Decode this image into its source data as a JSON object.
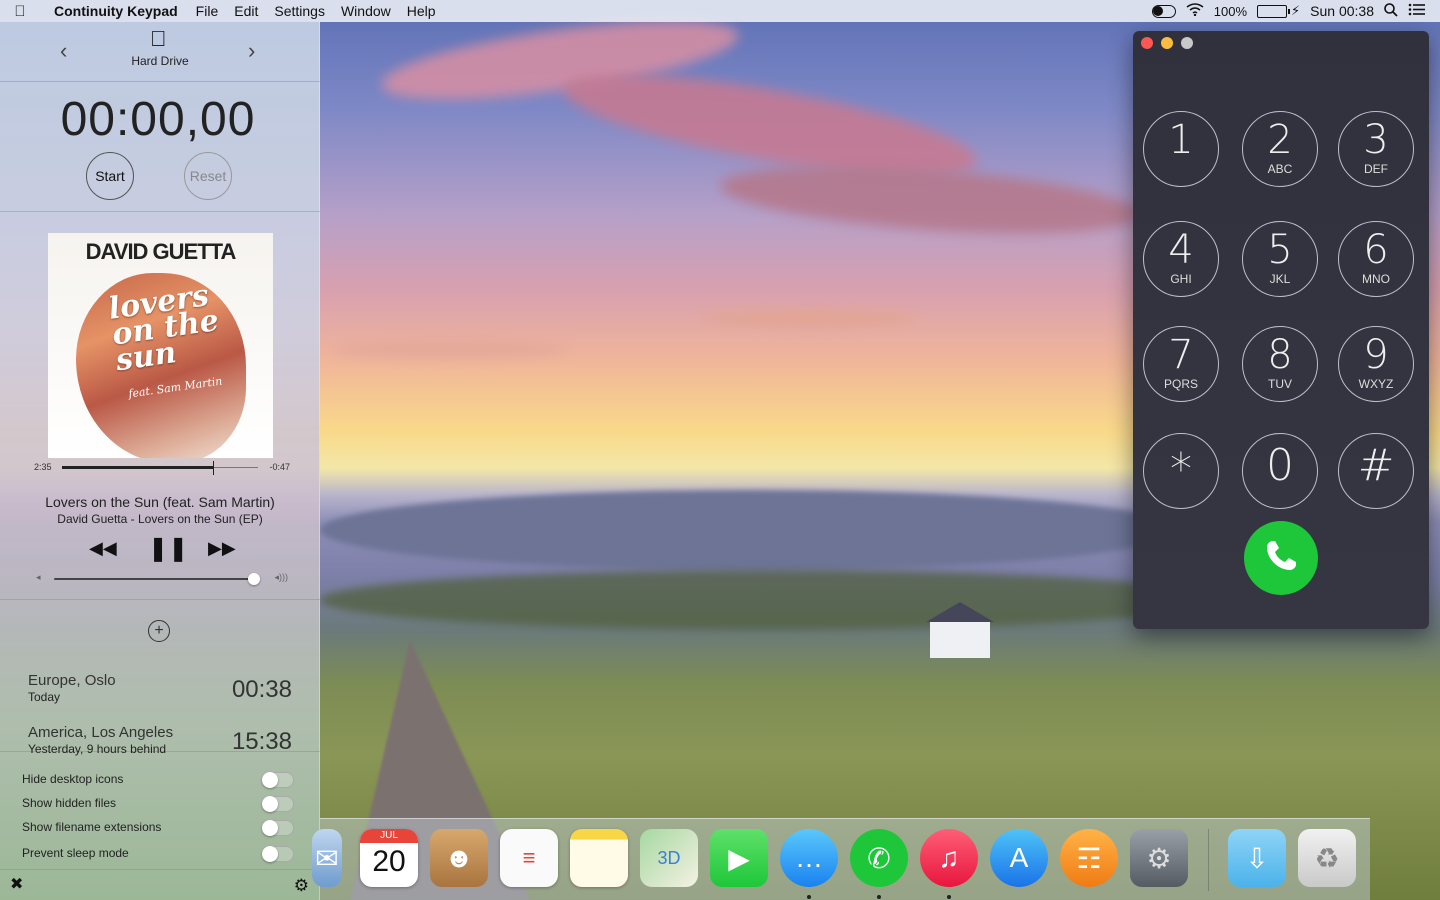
{
  "menubar": {
    "app_name": "Continuity Keypad",
    "menus": [
      "File",
      "Edit",
      "Settings",
      "Window",
      "Help"
    ],
    "battery_percent": "100%",
    "clock": "Sun 00:38",
    "icons": [
      "apple-icon",
      "toggle-icon",
      "wifi-icon",
      "battery-icon",
      "search-icon",
      "list-icon"
    ]
  },
  "panel": {
    "device": {
      "name": "Hard Drive",
      "prev_icon": "chevron-left-icon",
      "next_icon": "chevron-right-icon"
    },
    "stopwatch": {
      "display": "00:00,00",
      "start_label": "Start",
      "reset_label": "Reset"
    },
    "music": {
      "album_artist_logo": "DAVID GUETTA",
      "album_title": "lovers on the sun",
      "album_feat": "feat. Sam Martin",
      "elapsed": "2:35",
      "remaining": "-0:47",
      "progress": 0.77,
      "song_title": "Lovers on the Sun (feat. Sam Martin)",
      "song_subtitle": "David Guetta - Lovers on the Sun (EP)",
      "volume": 1.0
    },
    "world_clock": {
      "add_label": "+",
      "clocks": [
        {
          "city": "Europe, Oslo",
          "day": "Today",
          "time": "00:38"
        },
        {
          "city": "America, Los Angeles",
          "day": "Yesterday, 9 hours behind",
          "time": "15:38"
        }
      ]
    },
    "settings": {
      "items": [
        {
          "label": "Hide desktop icons",
          "on": false
        },
        {
          "label": "Show hidden files",
          "on": false
        },
        {
          "label": "Show filename extensions",
          "on": false
        },
        {
          "label": "Prevent sleep mode",
          "on": false
        }
      ]
    },
    "footer": {
      "close_icon": "close-icon",
      "gear_icon": "gear-icon"
    }
  },
  "keypad": {
    "keys": [
      {
        "digit": "1",
        "letters": ""
      },
      {
        "digit": "2",
        "letters": "ABC"
      },
      {
        "digit": "3",
        "letters": "DEF"
      },
      {
        "digit": "4",
        "letters": "GHI"
      },
      {
        "digit": "5",
        "letters": "JKL"
      },
      {
        "digit": "6",
        "letters": "MNO"
      },
      {
        "digit": "7",
        "letters": "PQRS"
      },
      {
        "digit": "8",
        "letters": "TUV"
      },
      {
        "digit": "9",
        "letters": "WXYZ"
      },
      {
        "digit": "*",
        "letters": ""
      },
      {
        "digit": "0",
        "letters": ""
      },
      {
        "digit": "#",
        "letters": ""
      }
    ],
    "call_icon": "phone-icon",
    "call_color": "#1ec739"
  },
  "dock": {
    "calendar_month": "JUL",
    "calendar_day": "20",
    "apps": [
      "mail-icon",
      "calendar-icon",
      "contacts-icon",
      "reminders-icon",
      "notes-icon",
      "maps-icon",
      "facetime-icon",
      "messages-icon",
      "phone-icon",
      "itunes-icon",
      "app-store-icon",
      "ibooks-icon",
      "system-preferences-icon",
      "downloads-folder-icon",
      "trash-icon"
    ]
  }
}
